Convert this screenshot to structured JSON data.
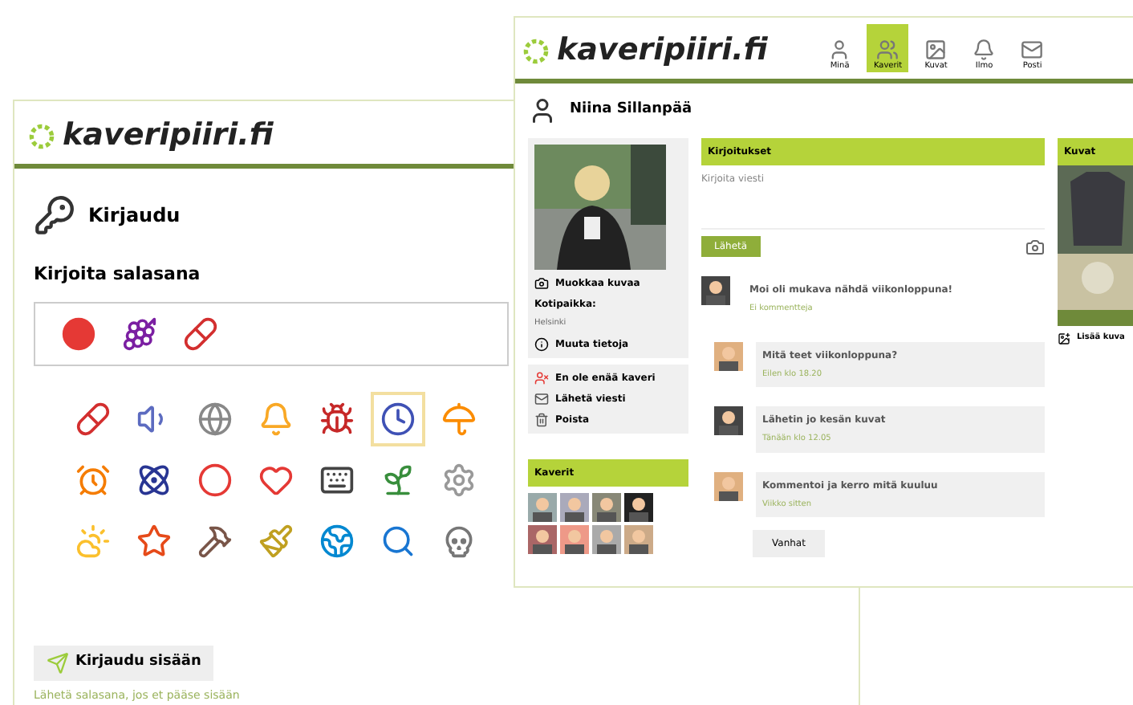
{
  "login_window": {
    "logo": "kaveripiiri.fi",
    "title": "Kirjaudu",
    "password_label": "Kirjoita salasana",
    "icons": [
      {
        "selected": false
      },
      {
        "selected": false
      },
      {
        "selected": false
      },
      {
        "selected": false
      },
      {
        "selected": false
      },
      {
        "selected": true
      },
      {
        "selected": false
      },
      {
        "selected": false
      },
      {
        "selected": false
      },
      {
        "selected": false
      },
      {
        "selected": false
      },
      {
        "selected": false
      },
      {
        "selected": false
      },
      {
        "selected": false
      },
      {
        "selected": false
      },
      {
        "selected": false
      },
      {
        "selected": false
      },
      {
        "selected": false
      },
      {
        "selected": false
      },
      {
        "selected": false
      },
      {
        "selected": false
      }
    ],
    "login_button": "Kirjaudu sisään",
    "help_link": "Lähetä salasana, jos et pääse sisään"
  },
  "profile_window": {
    "logo": "kaveripiiri.fi",
    "nav": [
      {
        "label": "Minä",
        "selected": false
      },
      {
        "label": "Kaverit",
        "selected": true
      },
      {
        "label": "Kuvat",
        "selected": false
      },
      {
        "label": "Ilmo",
        "selected": false
      },
      {
        "label": "Posti",
        "selected": false
      }
    ],
    "name": "Niina Sillanpää",
    "profile_links": [
      "Muokkaa kuvaa"
    ],
    "home_label": "Kotipaikka:",
    "home_value": "Helsinki",
    "more_link": "Muuta tietoja",
    "actions": [
      "En ole enää kaveri",
      "Lähetä viesti",
      "Poista"
    ],
    "friends_title": "Kaverit",
    "posts_title": "Kirjoitukset",
    "message_placeholder": "Kirjoita viesti",
    "send_button": "Lähetä",
    "posts": [
      {
        "text": "Moi oli mukava nähdä viikonloppuna!",
        "meta": "Ei kommentteja"
      },
      {
        "text": "Mitä teet viikonloppuna?",
        "meta": "Eilen klo 18.20"
      },
      {
        "text": "Lähetin jo kesän kuvat",
        "meta": "Tänään klo 12.05"
      },
      {
        "text": "Kommentoi ja kerro mitä kuuluu",
        "meta": "Viikko sitten"
      }
    ],
    "more_button": "Vanhat",
    "photos_title": "Kuvat",
    "add_photo": "Lisää kuva"
  }
}
